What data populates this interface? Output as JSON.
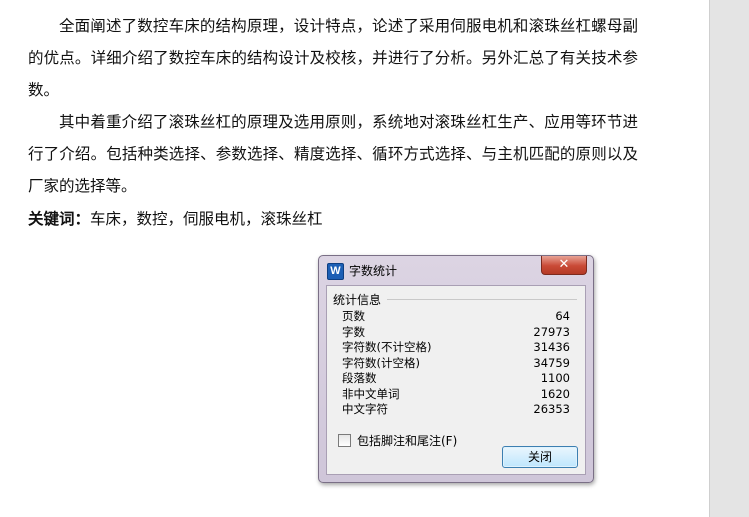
{
  "document": {
    "paragraph1": "全面阐述了数控车床的结构原理，设计特点，论述了采用伺服电机和滚珠丝杠螺母副的优点。详细介绍了数控车床的结构设计及校核，并进行了分析。另外汇总了有关技术参数。",
    "paragraph2": "其中着重介绍了滚珠丝杠的原理及选用原则，系统地对滚珠丝杠生产、应用等环节进行了介绍。包括种类选择、参数选择、精度选择、循环方式选择、与主机匹配的原则以及厂家的选择等。",
    "keywords_label": "关键词：",
    "keywords_value": "车床，数控，伺服电机，滚珠丝杠"
  },
  "dialog": {
    "icon_letter": "W",
    "title": "字数统计",
    "close_glyph": "✕",
    "group_label": "统计信息",
    "stats": [
      {
        "label": "页数",
        "value": "64"
      },
      {
        "label": "字数",
        "value": "27973"
      },
      {
        "label": "字符数(不计空格)",
        "value": "31436"
      },
      {
        "label": "字符数(计空格)",
        "value": "34759"
      },
      {
        "label": "段落数",
        "value": "1100"
      },
      {
        "label": "非中文单词",
        "value": "1620"
      },
      {
        "label": "中文字符",
        "value": "26353"
      }
    ],
    "checkbox_label": "包括脚注和尾注(F)",
    "checkbox_checked": false,
    "close_button": "关闭"
  }
}
